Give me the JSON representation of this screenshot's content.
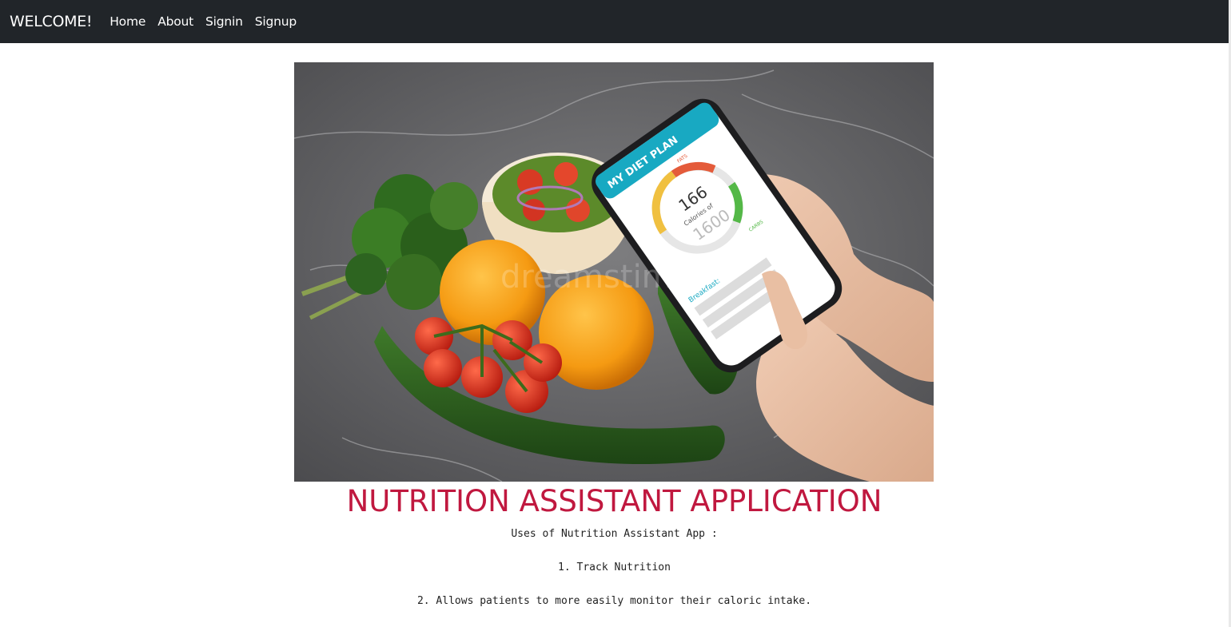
{
  "navbar": {
    "brand": "WELCOME!",
    "links": [
      "Home",
      "About",
      "Signin",
      "Signup"
    ],
    "background": "#212529"
  },
  "hero": {
    "phone_app_title": "MY DIET PLAN",
    "calories_value": "166",
    "calories_label": "Calories of",
    "calories_goal": "1600",
    "fats_label": "FATS",
    "carbs_label": "CARBS",
    "breakfast_label": "Breakfast:",
    "watermark": "dreamstime"
  },
  "main": {
    "title": "NUTRITION ASSISTANT APPLICATION",
    "title_color": "#c0183f",
    "intro": "Uses of Nutrition Assistant App :",
    "uses": [
      "1. Track Nutrition",
      "2. Allows patients to more easily monitor their caloric intake."
    ]
  }
}
